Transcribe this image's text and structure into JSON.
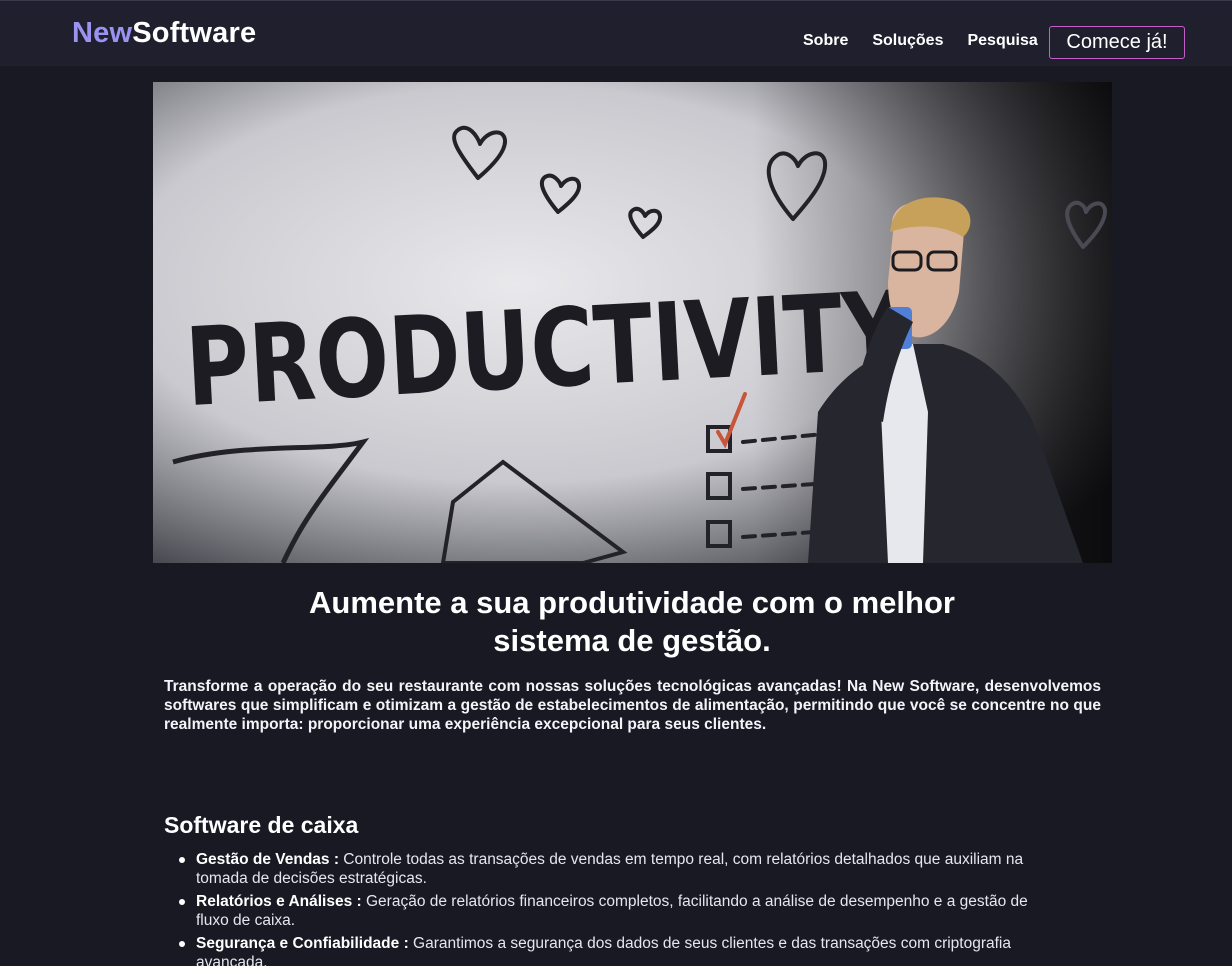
{
  "brand": {
    "part1": "New",
    "part2": "Software"
  },
  "nav": {
    "links": [
      "Sobre",
      "Soluções",
      "Pesquisa"
    ],
    "cta": "Comece já!"
  },
  "hero": {
    "wall_text": "PRODUCTIVITY"
  },
  "main": {
    "headline_line1": "Aumente a sua produtividade com o melhor",
    "headline_line2": "sistema de gestão.",
    "intro": "Transforme a operação do seu restaurante com nossas soluções tecnológicas avançadas! Na New Software, desenvolvemos softwares que simplificam e otimizam a gestão de estabelecimentos de alimentação, permitindo que você se concentre no que realmente importa: proporcionar uma experiência excepcional para seus clientes."
  },
  "section": {
    "title": "Software de caixa",
    "features": [
      {
        "title": "Gestão de Vendas :",
        "text": " Controle todas as transações de vendas em tempo real, com relatórios detalhados que auxiliam na tomada de decisões estratégicas."
      },
      {
        "title": "Relatórios e Análises :",
        "text": " Geração de relatórios financeiros completos, facilitando a análise de desempenho e a gestão de fluxo de caixa."
      },
      {
        "title": "Segurança e Confiabilidade :",
        "text": " Garantimos a segurança dos dados de seus clientes e das transações com criptografia avançada."
      }
    ]
  },
  "colors": {
    "background": "#191924",
    "navbar": "#1f1f2d",
    "brand_accent": "#9b93f0",
    "cta_border": "#c65ec9"
  }
}
